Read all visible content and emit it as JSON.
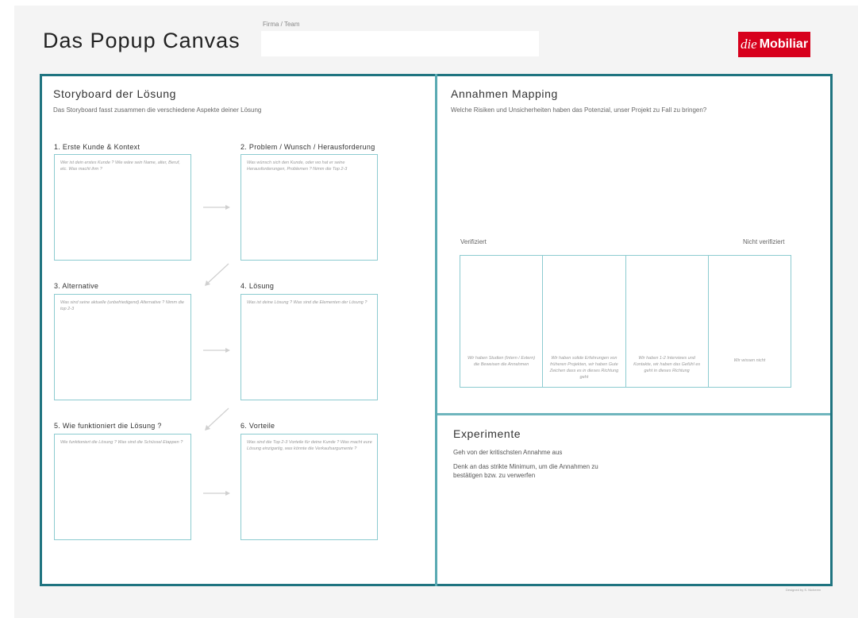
{
  "header": {
    "title": "Das Popup Canvas",
    "firma_label": "Firma / Team",
    "firma_value": "",
    "logo_die": "die",
    "logo_mobiliar": "Mobiliar",
    "logo_color": "#d7001c"
  },
  "storyboard": {
    "title": "Storyboard der Lösung",
    "subtitle": "Das Storyboard fasst zusammen die verschiedene Aspekte deiner Lösung",
    "steps": [
      {
        "label": "1. Erste Kunde & Kontext",
        "hint": "Wer ist dein erstes Kunde ? Wie wäre sein Name, alter, Beruf, etc. Was macht ihm ?"
      },
      {
        "label": "2. Problem / Wunsch / Herausforderung",
        "hint": "Was wünsch sich den Kunde, oder wo hat er seine Herausforderungen, Problemen ? Nimm die Top 2-3"
      },
      {
        "label": "3. Alternative",
        "hint": "Was sind seine aktuelle (unbefriedigend) Alternative ? Nimm die top 2-3"
      },
      {
        "label": "4. Lösung",
        "hint": "Was ist deine Lösung ? Was sind die Elementen der Lösung ?"
      },
      {
        "label": "5. Wie funktioniert die Lösung ?",
        "hint": "Wie funktioniert die Lösung ? Was sind die Schüssel Etappen ?"
      },
      {
        "label": "6. Vorteile",
        "hint": "Was sind die Top 2-3 Vorteile für deine Kunde ? Was macht eure Lösung einzigartig, was könnte die Verkaufsargumente ?"
      }
    ]
  },
  "annahmen": {
    "title": "Annahmen Mapping",
    "subtitle": "Welche Risiken und Unsicherheiten haben das Potenzial, unser Projekt zu Fall zu bringen?",
    "left_label": "Verifiziert",
    "right_label": "Nicht verifiziert",
    "columns": [
      "Wir haben Studien (Intern / Extern) die Beweisen die Annahmen",
      "Wir haben solide Erfahrungen von früheren Projekten, wir haben Gute Zeichen dass es in dieses Richtung geht",
      "Wir haben 1-2 Interviews und Kontakte, wir haben das Gefühl es geht in dieses Richtung",
      "Wir wissen nicht"
    ]
  },
  "experimente": {
    "title": "Experimente",
    "line1": "Geh von der kritischsten Annahme aus",
    "line2": "Denk an das strikte Minimum, um die Annahmen zu bestätigen bzw. zu verwerfen"
  },
  "footer": {
    "credit": "Designed by S. Nicheren"
  },
  "colors": {
    "frame": "#1f7480",
    "box_border": "#8ccbd0",
    "arrow": "#d0d0d0"
  }
}
